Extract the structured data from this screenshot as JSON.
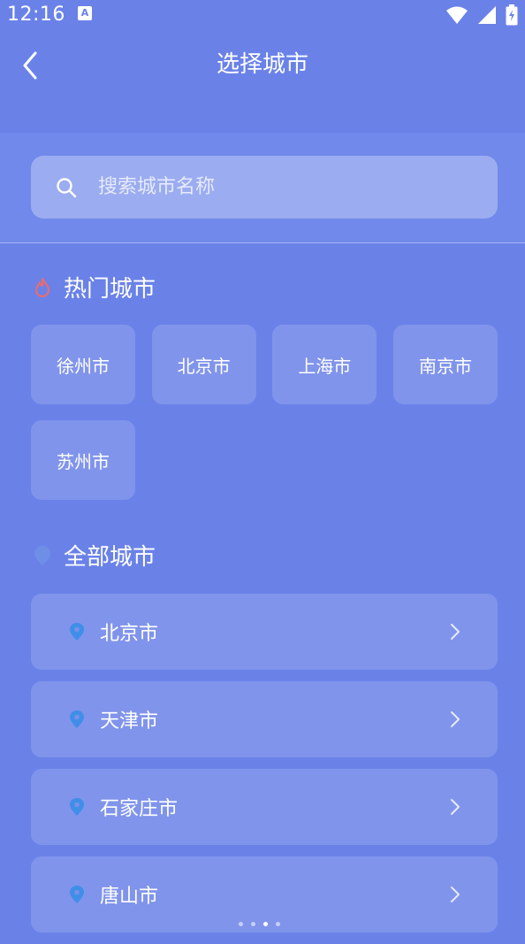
{
  "status_bar": {
    "time": "12:16",
    "app_icon_text": "A"
  },
  "header": {
    "title": "选择城市"
  },
  "search": {
    "placeholder": "搜索城市名称"
  },
  "hot_cities": {
    "title": "热门城市",
    "items": [
      "徐州市",
      "北京市",
      "上海市",
      "南京市",
      "苏州市"
    ]
  },
  "all_cities": {
    "title": "全部城市",
    "items": [
      "北京市",
      "天津市",
      "石家庄市",
      "唐山市"
    ]
  },
  "colors": {
    "background": "#6a82e8",
    "fire_icon": "#f06a6a",
    "pin_icon": "#3f8fe8"
  }
}
